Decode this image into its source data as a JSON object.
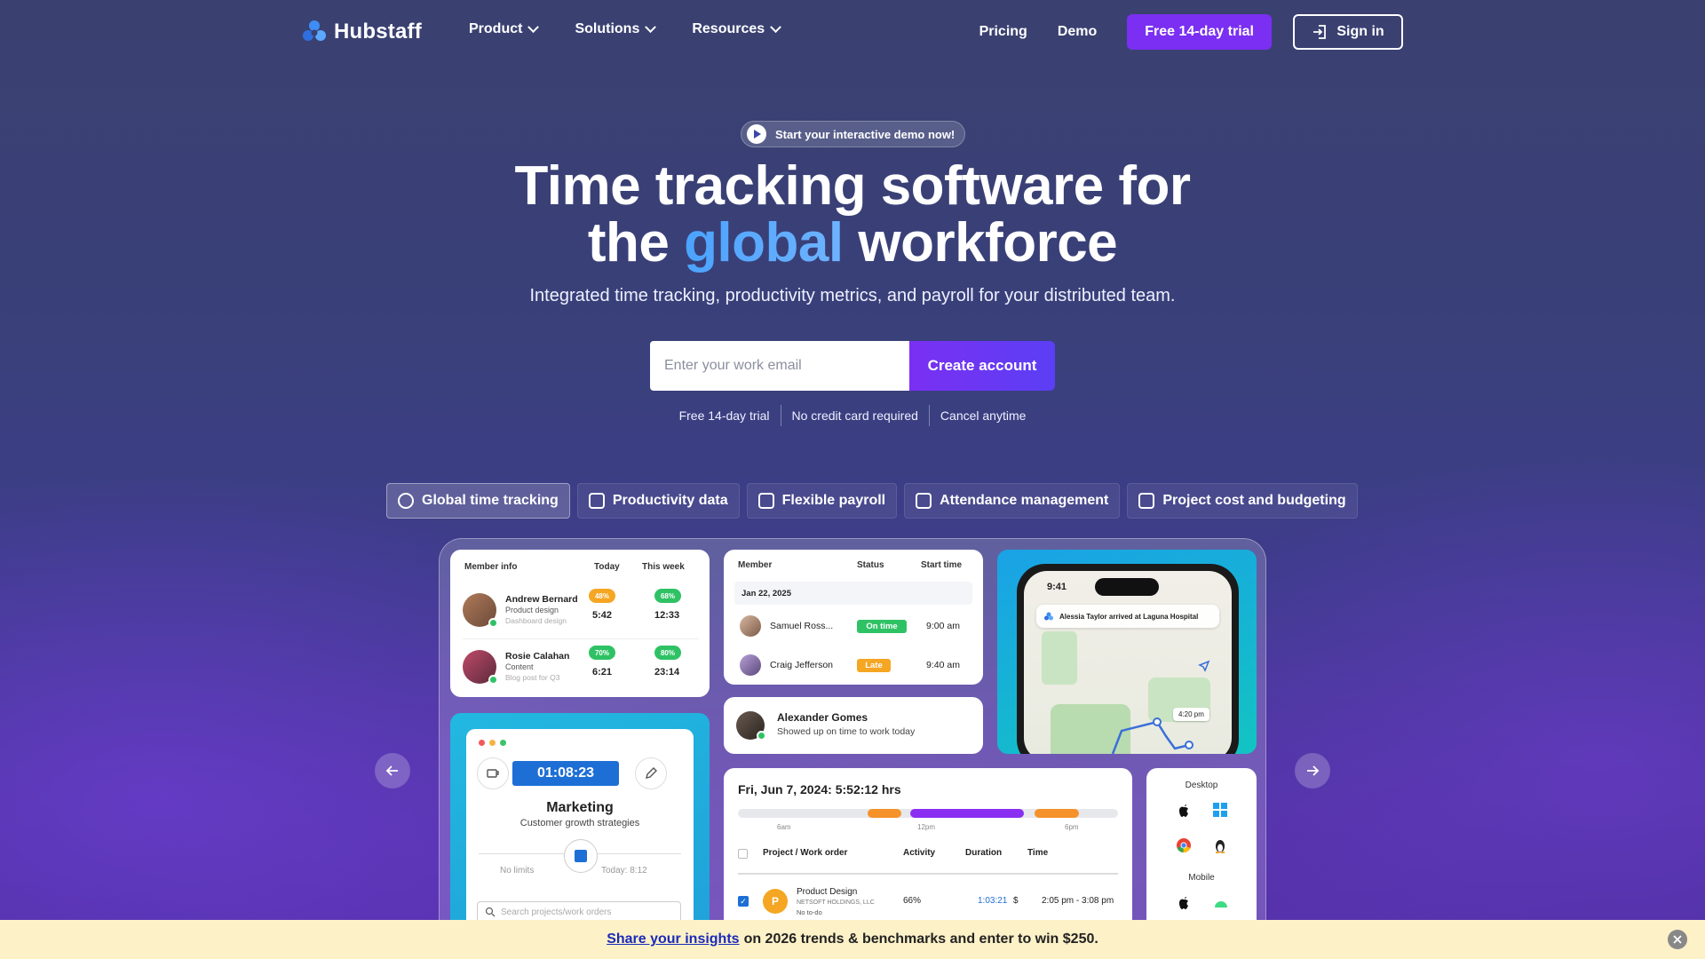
{
  "nav": {
    "logo_text": "Hubstaff",
    "menu": [
      {
        "label": "Product"
      },
      {
        "label": "Solutions"
      },
      {
        "label": "Resources"
      }
    ],
    "pricing": "Pricing",
    "demo": "Demo",
    "trial_button": "Free 14-day trial",
    "signin_button": "Sign in"
  },
  "hero": {
    "demo_pill": "Start your interactive demo now!",
    "headline_line1": "Time tracking software for",
    "headline_the": "the ",
    "headline_global": "global",
    "headline_workforce": " workforce",
    "subhead": "Integrated time tracking, productivity metrics, and payroll for your distributed team.",
    "email_placeholder": "Enter your work email",
    "create_button": "Create account",
    "perks": [
      "Free 14-day trial",
      "No credit card required",
      "Cancel anytime"
    ]
  },
  "tabs": [
    {
      "label": "Global time tracking",
      "active": true
    },
    {
      "label": "Productivity data",
      "active": false
    },
    {
      "label": "Flexible payroll",
      "active": false
    },
    {
      "label": "Attendance management",
      "active": false
    },
    {
      "label": "Project cost and budgeting",
      "active": false
    }
  ],
  "members_card": {
    "headers": [
      "Member info",
      "Today",
      "This week"
    ],
    "rows": [
      {
        "name": "Andrew Bernard",
        "role": "Product design",
        "task": "Dashboard design",
        "today_pct": "48%",
        "today_time": "5:42",
        "week_pct": "68%",
        "week_time": "12:33"
      },
      {
        "name": "Rosie Calahan",
        "role": "Content",
        "task": "Blog post for Q3",
        "today_pct": "70%",
        "today_time": "6:21",
        "week_pct": "80%",
        "week_time": "23:14"
      }
    ]
  },
  "timer_card": {
    "timer": "01:08:23",
    "project": "Marketing",
    "task": "Customer growth strategies",
    "limit_left": "No limits",
    "limit_right": "Today: 8:12",
    "search_placeholder": "Search projects/work orders"
  },
  "attendance_card": {
    "headers": [
      "Member",
      "Status",
      "Start time"
    ],
    "date": "Jan 22, 2025",
    "rows": [
      {
        "name": "Samuel Ross...",
        "status": "On time",
        "start": "9:00 am"
      },
      {
        "name": "Craig Jefferson",
        "status": "Late",
        "start": "9:40 am"
      }
    ]
  },
  "notification_card": {
    "name": "Alexander Gomes",
    "message": "Showed up on time to work today"
  },
  "map_card": {
    "time": "9:41",
    "alert": "Alessia Taylor arrived at Laguna Hospital",
    "stamp": "4:20 pm"
  },
  "timeline_card": {
    "title": "Fri, Jun 7, 2024: 5:52:12 hrs",
    "ticks": [
      "6am",
      "12pm",
      "6pm"
    ],
    "headers": [
      "Project / Work order",
      "Activity",
      "Duration",
      "Time"
    ],
    "row": {
      "initial": "P",
      "project": "Product Design",
      "client": "NETSOFT HOLDINGS, LLC",
      "todo": "No to-do",
      "activity": "66%",
      "duration": "1:03:21",
      "currency": "$",
      "time": "2:05 pm - 3:08 pm"
    }
  },
  "platforms_card": {
    "desktop": "Desktop",
    "mobile": "Mobile"
  },
  "banner": {
    "link": "Share your insights",
    "text": "on 2026 trends & benchmarks and enter to win $250."
  },
  "colors": {
    "primary_purple": "#7a2ff2",
    "timer_blue": "#1d6fd6",
    "green": "#2fc265",
    "orange": "#f5a623",
    "banner_bg": "#fdf1c7"
  }
}
